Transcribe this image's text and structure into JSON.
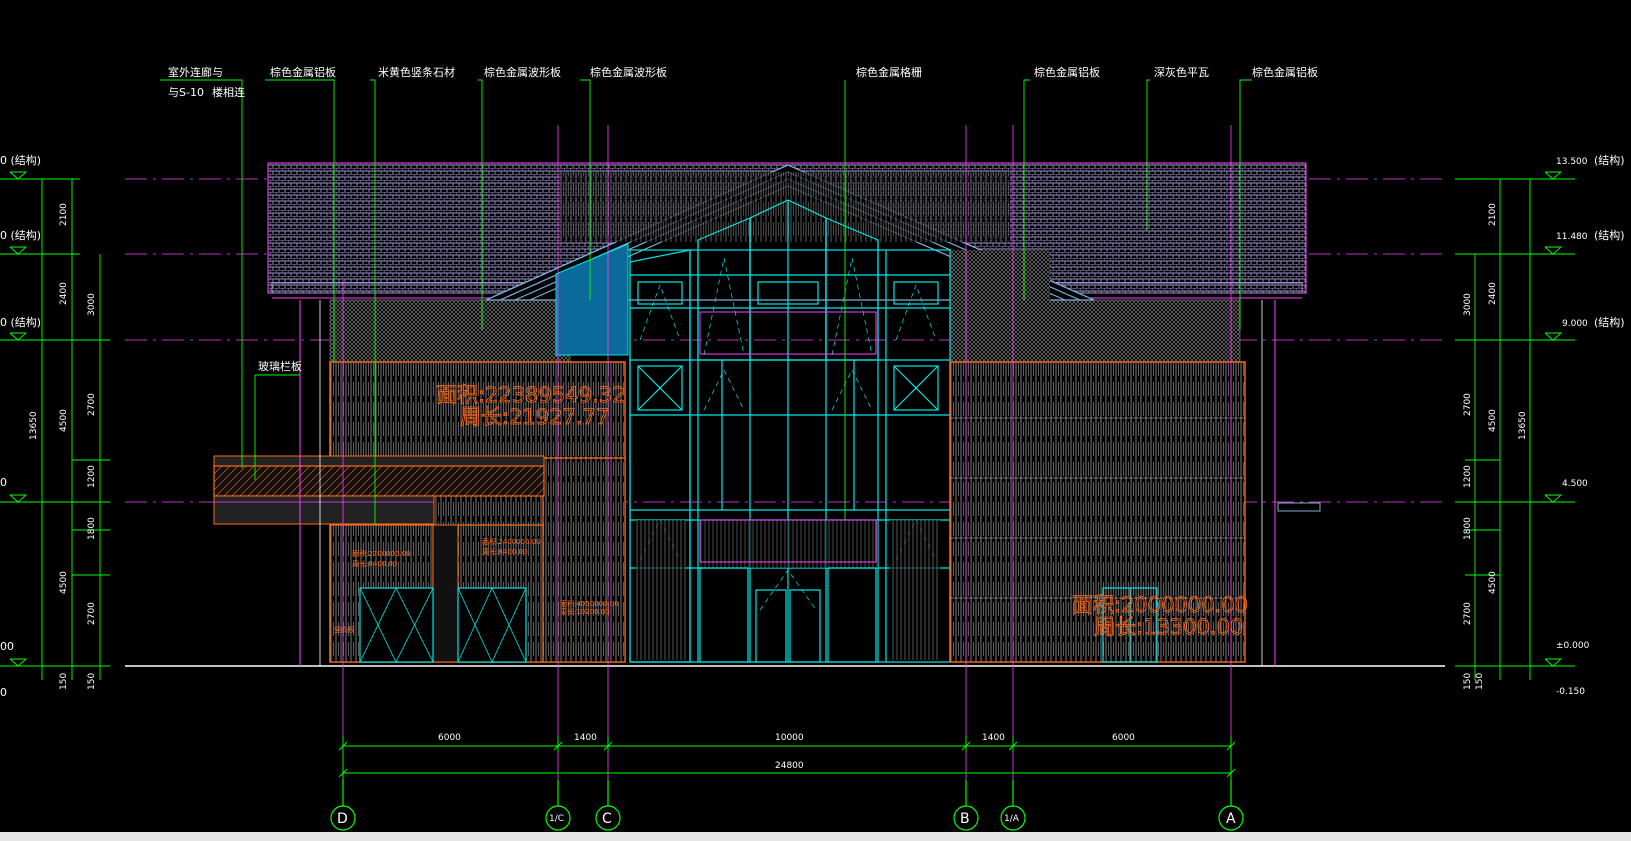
{
  "labels": {
    "l1a": "室外连廊与",
    "l1b": "与S-10",
    "l1c": "楼相连",
    "l2": "棕色金属铝板",
    "l3": "米黄色竖条石材",
    "l4": "棕色金属波形板",
    "l5": "棕色金属波形板",
    "l6": "棕色金属格栅",
    "l7": "棕色金属铝板",
    "l8": "深灰色平瓦",
    "l9": "棕色金属铝板",
    "l10": "玻璃栏板"
  },
  "left_levels": [
    {
      "id": "lv-13500",
      "text": "0  (结构)"
    },
    {
      "id": "lv-11480",
      "text": "0  (结构)"
    },
    {
      "id": "lv-9000",
      "text": "0  (结构)"
    },
    {
      "id": "lv-4500",
      "text": "0"
    },
    {
      "id": "lv-0",
      "text": "00"
    },
    {
      "id": "lv-m150",
      "text": "0"
    }
  ],
  "right_levels": [
    {
      "id": "rv-13500",
      "text": "13.500",
      "note": "(结构)"
    },
    {
      "id": "rv-11480",
      "text": "11.480",
      "note": "(结构)"
    },
    {
      "id": "rv-9000",
      "text": "9.000",
      "note": "(结构)"
    },
    {
      "id": "rv-4500",
      "text": "4.500",
      "note": ""
    },
    {
      "id": "rv-0",
      "text": "±0.000",
      "note": ""
    },
    {
      "id": "rv-m150",
      "text": "-0.150",
      "note": ""
    }
  ],
  "vertical_dims": {
    "left_a": [
      "2100",
      "2400",
      "4500",
      "1200",
      "1800",
      "2700",
      "150"
    ],
    "left_b": [
      "3000",
      "2700",
      "1800",
      "4500",
      "13650",
      "150"
    ],
    "right_a": [
      "2100",
      "2400",
      "3000",
      "2700",
      "4500",
      "13650",
      "1200",
      "1800",
      "2700",
      "150"
    ],
    "right_b": [
      "4500",
      "150",
      "150"
    ]
  },
  "horizontal_dims": {
    "segments": [
      "6000",
      "1400",
      "10000",
      "1400",
      "6000"
    ],
    "total": "24800"
  },
  "axes": [
    {
      "id": "ax-d",
      "text": "D"
    },
    {
      "id": "ax-1c",
      "text": "1/C"
    },
    {
      "id": "ax-c",
      "text": "C"
    },
    {
      "id": "ax-b",
      "text": "B"
    },
    {
      "id": "ax-1a",
      "text": "1/A"
    },
    {
      "id": "ax-a",
      "text": "A"
    }
  ],
  "area_notes": {
    "upper_left_1": "面积:22389549.32",
    "upper_left_2": "周长:21927.77",
    "lower_right_1": "面积:2000000.00",
    "lower_right_2": "周长:13300.00",
    "small_1": "面积:2700000.00",
    "small_2": "周长:8400.00",
    "small_3": "面积:2400000.00",
    "small_4": "周长:8400.00",
    "small_5": "面积:4050000.00",
    "small_6": "周长:10200.00",
    "small_7": "竖向板"
  },
  "colors": {
    "green": "#00ff00",
    "magenta": "#ff40ff",
    "orange": "#ff6a1a",
    "cyan": "#00e5e5",
    "white": "#ffffff",
    "roof": "#9a90c8",
    "blue_fill": "#0a6a9a"
  }
}
